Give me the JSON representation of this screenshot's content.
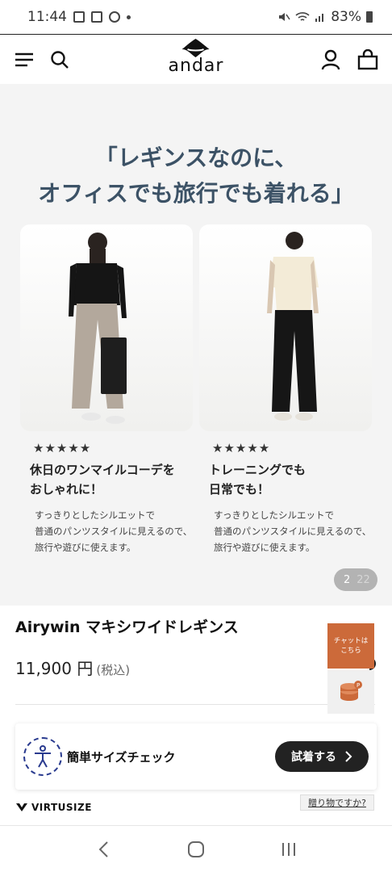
{
  "status_bar": {
    "time": "11:44",
    "battery": "83%"
  },
  "header": {
    "logo_text": "andar",
    "icons": [
      "menu-icon",
      "search-icon",
      "user-icon",
      "bag-icon"
    ]
  },
  "promo": {
    "headline_line1": "「レギンスなのに、",
    "headline_line2": "オフィスでも旅行でも着れる」",
    "cards": [
      {
        "stars": "★★★★★",
        "title_line1": "休日のワンマイルコーデを",
        "title_line2": "おしゃれに！",
        "desc_line1": "すっきりとしたシルエットで",
        "desc_line2": "普通のパンツスタイルに見えるので、",
        "desc_line3": "旅行や遊びに使えます。"
      },
      {
        "stars": "★★★★★",
        "title_line1": "トレーニングでも",
        "title_line2": "日常でも！",
        "desc_line1": "すっきりとしたシルエットで",
        "desc_line2": "普通のパンツスタイルに見えるので、",
        "desc_line3": "旅行や遊びに使えます。"
      }
    ],
    "pager_current": "2",
    "pager_total": "22"
  },
  "product": {
    "name": "Airywin マキシワイドレギンス",
    "price": "11,900 円",
    "tax_note": "(税込)"
  },
  "chat_widget": {
    "line1": "チャットは",
    "line2": "こちら"
  },
  "virtusize": {
    "label": "簡単サイズチェック",
    "try_button": "試着する",
    "brand": "VIRTUSIZE",
    "gift_link": "贈り物ですか?"
  },
  "colors": {
    "headline": "#3c5266",
    "chat_bg": "#cc6a3a",
    "coin": "#cc6a3a",
    "virtusize_blue": "#2a3b8f"
  }
}
